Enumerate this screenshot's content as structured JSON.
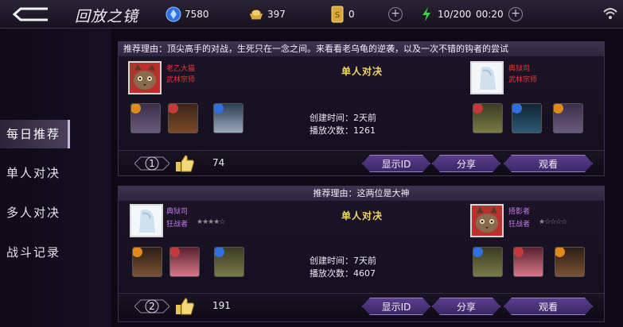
{
  "header": {
    "title": "回放之镜",
    "diamonds": "7580",
    "gold": "397",
    "tickets": "0",
    "energy": "10/200",
    "timer": "00:20",
    "colors": {
      "energy": "#3fd14b",
      "diamond": "#2f6fe0",
      "gold": "#d8a93a"
    }
  },
  "sidebar": {
    "items": [
      {
        "label": "每日推荐"
      },
      {
        "label": "单人对决"
      },
      {
        "label": "多人对决"
      },
      {
        "label": "战斗记录"
      }
    ]
  },
  "cards": [
    {
      "reason": "推荐理由：顶尖高手的对战，生死只在一念之间。来看看老乌龟的逆袭，以及一次不错的钩者的尝试",
      "mode": "单人对决",
      "left_player": {
        "name": "老乙大猫",
        "rank": "武林宗师"
      },
      "right_player": {
        "name": "典狱司",
        "rank": "武林宗师"
      },
      "created": "创建时间：2天前",
      "plays": "播放次数：1261",
      "index": "1",
      "likes": "74",
      "buttons": {
        "show_id": "显示ID",
        "share": "分享",
        "watch": "观看"
      }
    },
    {
      "reason": "推荐理由：这两位是大神",
      "mode": "单人对决",
      "left_player": {
        "name": "典狱司",
        "rank": "狂战者"
      },
      "right_player": {
        "name": "捂影者",
        "rank": "狂战者"
      },
      "created": "创建时间：7天前",
      "plays": "播放次数：4607",
      "index": "2",
      "likes": "191",
      "buttons": {
        "show_id": "显示ID",
        "share": "分享",
        "watch": "观看"
      }
    }
  ]
}
